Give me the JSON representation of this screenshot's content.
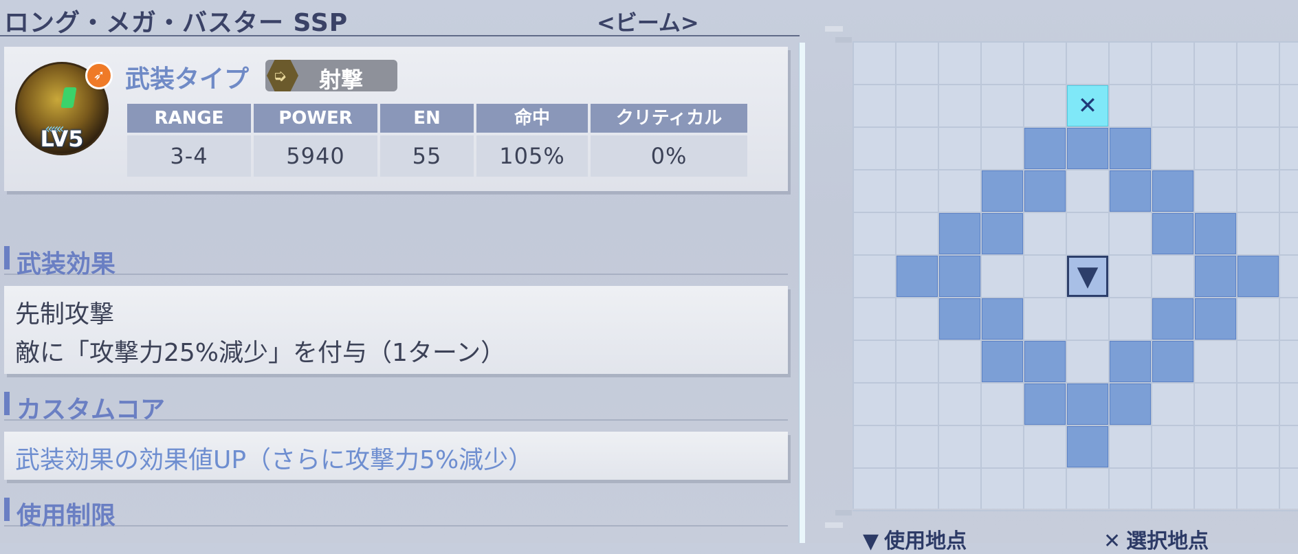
{
  "weapon": {
    "name": "ロング・メガ・バスター SSP",
    "attribute": "<ビーム>"
  },
  "unit": {
    "level": "LV5"
  },
  "type": {
    "label": "武装タイプ",
    "value": "射撃"
  },
  "stats": {
    "headers": [
      "RANGE",
      "POWER",
      "EN",
      "命中",
      "クリティカル"
    ],
    "values": [
      "3-4",
      "5940",
      "55",
      "105%",
      "0%"
    ]
  },
  "sections": {
    "effect": {
      "heading": "武装効果",
      "title": "先制攻撃",
      "description": "敵に「攻撃力25%減少」を付与（1ターン）"
    },
    "custom_core": {
      "heading": "カスタムコア",
      "text": "武装効果の効果値UP（さらに攻撃力5%減少）"
    },
    "restriction": {
      "heading": "使用制限"
    }
  },
  "range_grid": {
    "cols": 11,
    "rows": 11,
    "origin": [
      5,
      5
    ],
    "target": [
      5,
      1
    ],
    "range_cells": [
      [
        4,
        2
      ],
      [
        5,
        2
      ],
      [
        6,
        2
      ],
      [
        3,
        3
      ],
      [
        4,
        3
      ],
      [
        6,
        3
      ],
      [
        7,
        3
      ],
      [
        2,
        4
      ],
      [
        3,
        4
      ],
      [
        7,
        4
      ],
      [
        8,
        4
      ],
      [
        1,
        5
      ],
      [
        2,
        5
      ],
      [
        8,
        5
      ],
      [
        9,
        5
      ],
      [
        2,
        6
      ],
      [
        3,
        6
      ],
      [
        7,
        6
      ],
      [
        8,
        6
      ],
      [
        3,
        7
      ],
      [
        4,
        7
      ],
      [
        6,
        7
      ],
      [
        7,
        7
      ],
      [
        4,
        8
      ],
      [
        5,
        8
      ],
      [
        6,
        8
      ],
      [
        5,
        9
      ]
    ],
    "colors": {
      "range": "#7c9fd6",
      "origin_border": "#2c3e6a",
      "target": "#7fe8f8"
    }
  },
  "legend": {
    "use_point": "使用地点",
    "select_point": "選択地点"
  }
}
